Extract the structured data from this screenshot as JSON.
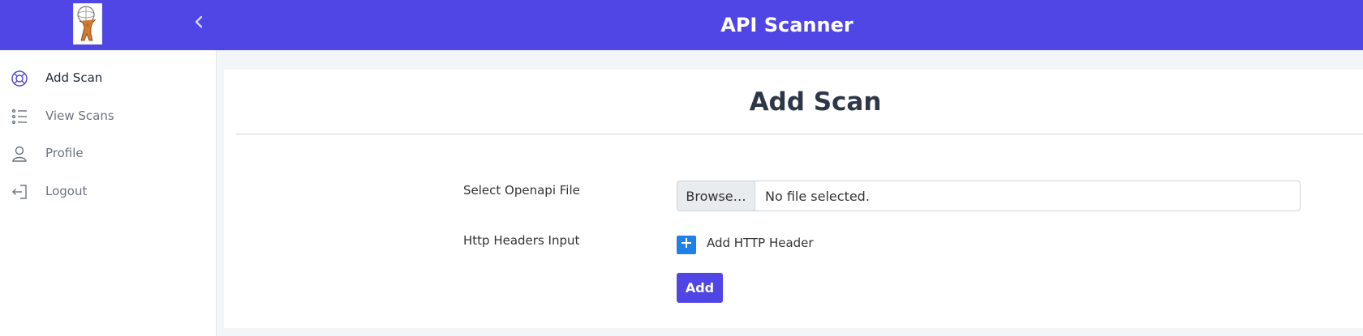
{
  "header": {
    "title": "API Scanner",
    "logo_icon": "atlas-logo-icon",
    "collapse_icon": "chevron-left-icon"
  },
  "sidebar": {
    "items": [
      {
        "label": "Add Scan",
        "icon": "lifebuoy-icon",
        "active": true
      },
      {
        "label": "View Scans",
        "icon": "list-icon",
        "active": false
      },
      {
        "label": "Profile",
        "icon": "user-icon",
        "active": false
      },
      {
        "label": "Logout",
        "icon": "logout-icon",
        "active": false
      }
    ]
  },
  "main": {
    "title": "Add Scan",
    "file_field": {
      "label": "Select Openapi File",
      "browse_label": "Browse…",
      "status": "No file selected."
    },
    "headers_field": {
      "label": "Http Headers Input",
      "add_header_label": "Add HTTP Header",
      "add_icon": "plus-icon"
    },
    "submit_label": "Add"
  },
  "colors": {
    "brand": "#4f46e5",
    "plus_button": "#1e80e8"
  }
}
